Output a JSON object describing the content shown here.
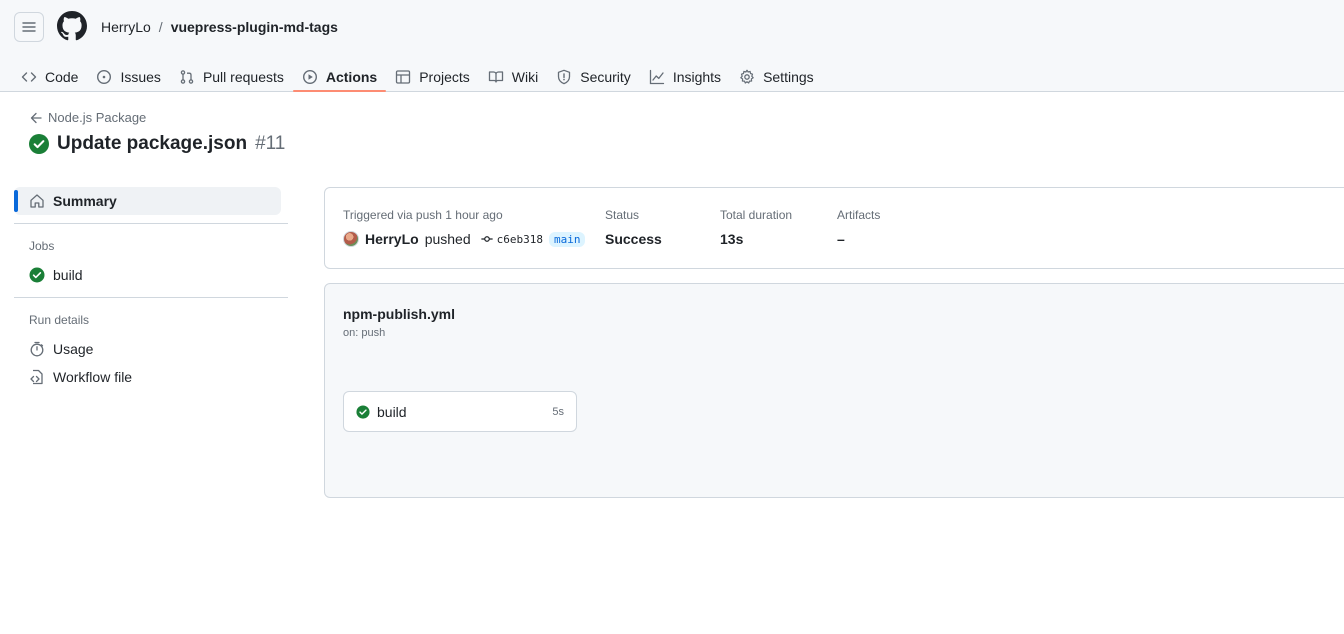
{
  "header": {
    "owner": "HerryLo",
    "separator": "/",
    "repo": "vuepress-plugin-md-tags"
  },
  "tabs": [
    {
      "label": "Code",
      "icon": "code-icon"
    },
    {
      "label": "Issues",
      "icon": "issue-icon"
    },
    {
      "label": "Pull requests",
      "icon": "pull-request-icon"
    },
    {
      "label": "Actions",
      "icon": "play-icon",
      "active": true
    },
    {
      "label": "Projects",
      "icon": "table-icon"
    },
    {
      "label": "Wiki",
      "icon": "book-icon"
    },
    {
      "label": "Security",
      "icon": "shield-icon"
    },
    {
      "label": "Insights",
      "icon": "graph-icon"
    },
    {
      "label": "Settings",
      "icon": "gear-icon"
    }
  ],
  "run": {
    "workflow_name": "Node.js Package",
    "title": "Update package.json",
    "number": "#11",
    "status_color": "#1a7f37"
  },
  "sidebar": {
    "summary_label": "Summary",
    "jobs_heading": "Jobs",
    "jobs": [
      {
        "label": "build"
      }
    ],
    "run_details_heading": "Run details",
    "usage_label": "Usage",
    "workflow_file_label": "Workflow file"
  },
  "summary": {
    "triggered_label": "Triggered via push 1 hour ago",
    "actor": "HerryLo",
    "action": "pushed",
    "commit": "c6eb318",
    "branch": "main",
    "status_label": "Status",
    "status_value": "Success",
    "duration_label": "Total duration",
    "duration_value": "13s",
    "artifacts_label": "Artifacts",
    "artifacts_value": "–"
  },
  "graph": {
    "file": "npm-publish.yml",
    "trigger": "on: push",
    "job": {
      "name": "build",
      "duration": "5s"
    }
  }
}
